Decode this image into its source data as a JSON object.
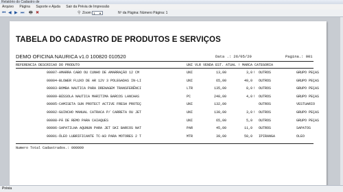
{
  "window": {
    "title": "Relatório do Cadastro de"
  },
  "menu": [
    "Arquivo",
    "Página",
    "Suporte e Ajuda",
    "Sair da Prévia de Impressão"
  ],
  "toolbar": {
    "nav_icons": [
      "first-page-icon",
      "prev-page-icon",
      "next-page-icon",
      "last-page-icon",
      "print-icon",
      "close-preview-icon"
    ],
    "zoom_label": "Zoom",
    "zoom_value": "1",
    "page_info": "Nº da Página: Número Página: 1"
  },
  "report": {
    "title": "TABELA DO CADASTRO DE PRODUTOS E SERVIÇOS",
    "company": "DEMO OFICINA NAURICA v1.0 100820 010520",
    "date": "Data .: 26/05/20",
    "page": "Pagina.: 001",
    "headers": {
      "ref_desc": "REFERENCIA DESCRICAO DO PRODUTO",
      "rest": "UNI VLR VENDA EST. ATUAL ! MARCA            CATEGORIA"
    },
    "rows": [
      {
        "desc": "00007-AMARRA CABO OU CUNHO DE AMARRAÇÃO 12 CM",
        "un": "UNI",
        "vlr": "13,00",
        "est": "3,0",
        "atu": "!",
        "marca": "OUTROS",
        "cat": "GRUPO PEÇAS"
      },
      {
        "desc": "00004-BLOWER FLUXO DE AR 12V 3 POLEGADAS IN-LI",
        "un": "UNI",
        "vlr": "65,00",
        "est": "49,0",
        "atu": "",
        "marca": "OUTROS",
        "cat": "GRUPO PEÇAS"
      },
      {
        "desc": "00003-BOMBA NAUTICA PARA DRENAGEM TRANSFERÊNCI",
        "un": "LTR",
        "vlr": "135,00",
        "est": "8,0",
        "atu": "!",
        "marca": "OUTROS",
        "cat": "GRUPO PEÇAS"
      },
      {
        "desc": "00009-BÚSSOLA NAUTICA MARITIMA BARCOS LANCHAS",
        "un": "PC",
        "vlr": "240,00",
        "est": "4,0",
        "atu": "!",
        "marca": "OUTROS",
        "cat": "GRUPO PEÇAS"
      },
      {
        "desc": "00005-CAMISETA SUN PROTECT ACTIVE FRESH PROTEÇ",
        "un": "UNI",
        "vlr": "132,00",
        "est": "",
        "atu": "",
        "marca": "OUTROS",
        "cat": "VESTUARIO"
      },
      {
        "desc": "00002-GUINCHO MANUAL CATRACA P/ CARRETA OU JET",
        "un": "UNI",
        "vlr": "130,00",
        "est": "3,0",
        "atu": "!",
        "marca": "OUTROS",
        "cat": "GRUPO PEÇAS"
      },
      {
        "desc": "00008-PÁ DE REMO PARA CAIAQUES",
        "un": "UNI",
        "vlr": "65,00",
        "est": "5,0",
        "atu": "",
        "marca": "OUTROS",
        "cat": "GRUPO PEÇAS"
      },
      {
        "desc": "00006-SAPATILHA AQUNUN PARA JET SKI BARCOS NAT",
        "un": "PAR",
        "vlr": "45,00",
        "est": "11,0",
        "atu": "",
        "marca": "OUTROS",
        "cat": "SAPATOS"
      },
      {
        "desc": "00001-ÓLEO LUBRIFICANTE TC-W3 PARA MOTORES 2 T",
        "un": "MTR",
        "vlr": "39,00",
        "est": "50,0",
        "atu": "",
        "marca": "IPIRANGA",
        "cat": "OLEO"
      }
    ],
    "total": "Numero Total Cadastrados.: 000009"
  },
  "status": {
    "text": "Prévia"
  }
}
